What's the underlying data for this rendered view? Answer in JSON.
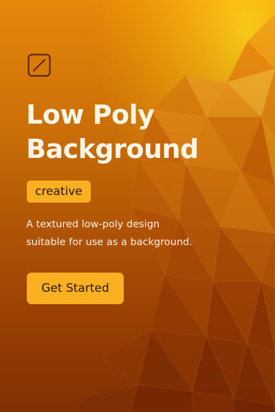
{
  "hero": {
    "logo_icon": "slashed-square-icon",
    "title_line1": "Low Poly",
    "title_line2": "Background",
    "badge": "creative",
    "description_line1": "A textured low-poly design",
    "description_line2": "suitable for use as a background.",
    "cta_label": "Get Started"
  },
  "colors": {
    "background_top": "#e8880a",
    "background_bottom": "#a84404",
    "accent": "#fbb022",
    "text_light": "#fff6e8",
    "text_dark": "#2b1605"
  }
}
